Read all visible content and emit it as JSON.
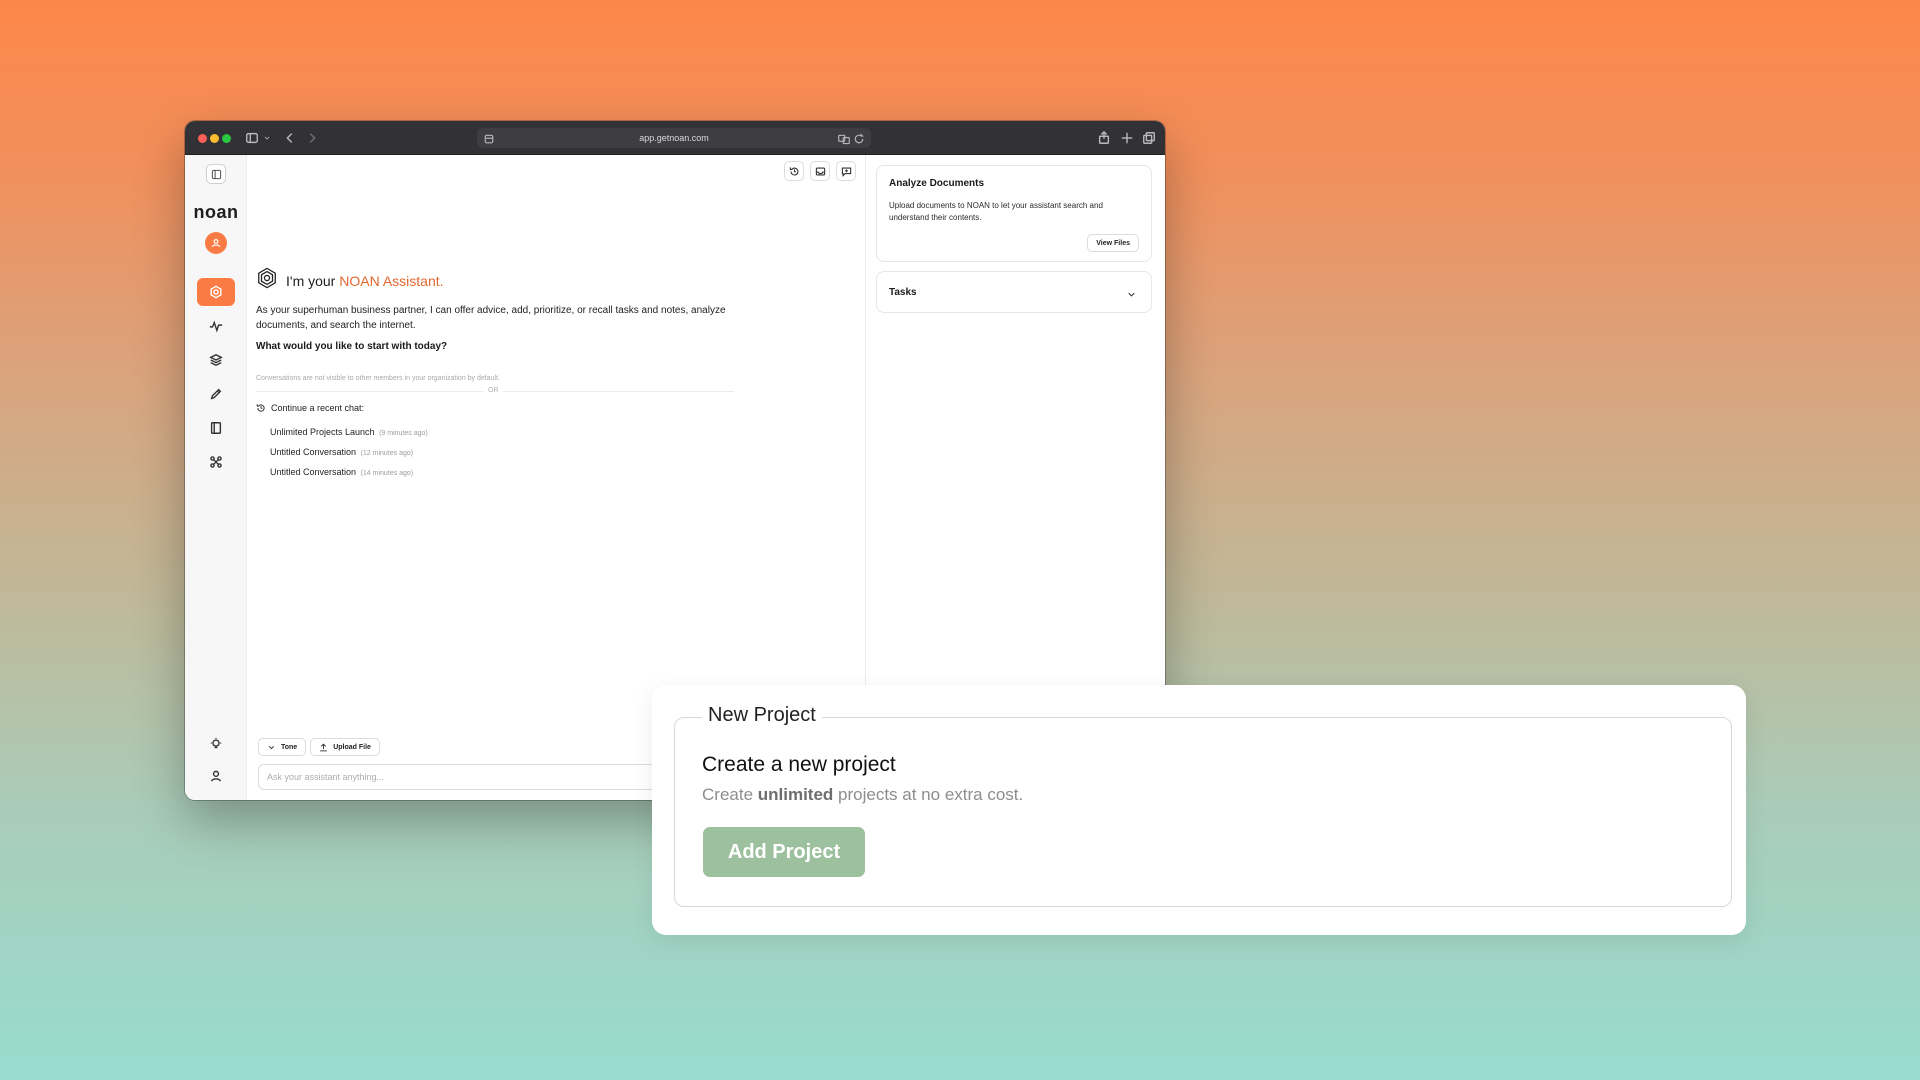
{
  "browser": {
    "url": "app.getnoan.com"
  },
  "sidebar": {
    "logo_text": "noan",
    "items": [
      {
        "icon": "assistant-icon",
        "active": true
      },
      {
        "icon": "activity-icon",
        "active": false
      },
      {
        "icon": "layers-icon",
        "active": false
      },
      {
        "icon": "pencil-icon",
        "active": false
      },
      {
        "icon": "notebook-icon",
        "active": false
      },
      {
        "icon": "integrations-icon",
        "active": false
      }
    ],
    "bottom_items": [
      {
        "icon": "lightbulb-icon"
      },
      {
        "icon": "user-icon"
      }
    ]
  },
  "assistant": {
    "greeting_prefix": "I'm your ",
    "greeting_accent": "NOAN Assistant.",
    "intro": "As your superhuman business partner, I can offer advice, add, prioritize, or recall tasks and notes, analyze documents, and search the internet.",
    "question": "What would you like to start with today?",
    "privacy_note": "Conversations are not visible to other members in your organization by default.",
    "or_label": "OR",
    "continue_label": "Continue a recent chat:",
    "recent_chats": [
      {
        "title": "Unlimited Projects Launch",
        "time": "(9 minutes ago)"
      },
      {
        "title": "Untitled Conversation",
        "time": "(12 minutes ago)"
      },
      {
        "title": "Untitled Conversation",
        "time": "(14 minutes ago)"
      }
    ]
  },
  "composer": {
    "tone_label": "Tone",
    "upload_label": "Upload File",
    "placeholder": "Ask your assistant anything..."
  },
  "right_panel": {
    "analyze": {
      "title": "Analyze Documents",
      "description": "Upload documents to NOAN to let your assistant search and understand their contents.",
      "button": "View Files"
    },
    "tasks": {
      "title": "Tasks"
    }
  },
  "new_project": {
    "legend": "New Project",
    "heading": "Create a new project",
    "sub_prefix": "Create ",
    "sub_strong": "unlimited",
    "sub_suffix": " projects at no extra cost.",
    "button": "Add Project"
  },
  "colors": {
    "accent": "#fa7b43",
    "button_green": "#9dc19f"
  }
}
